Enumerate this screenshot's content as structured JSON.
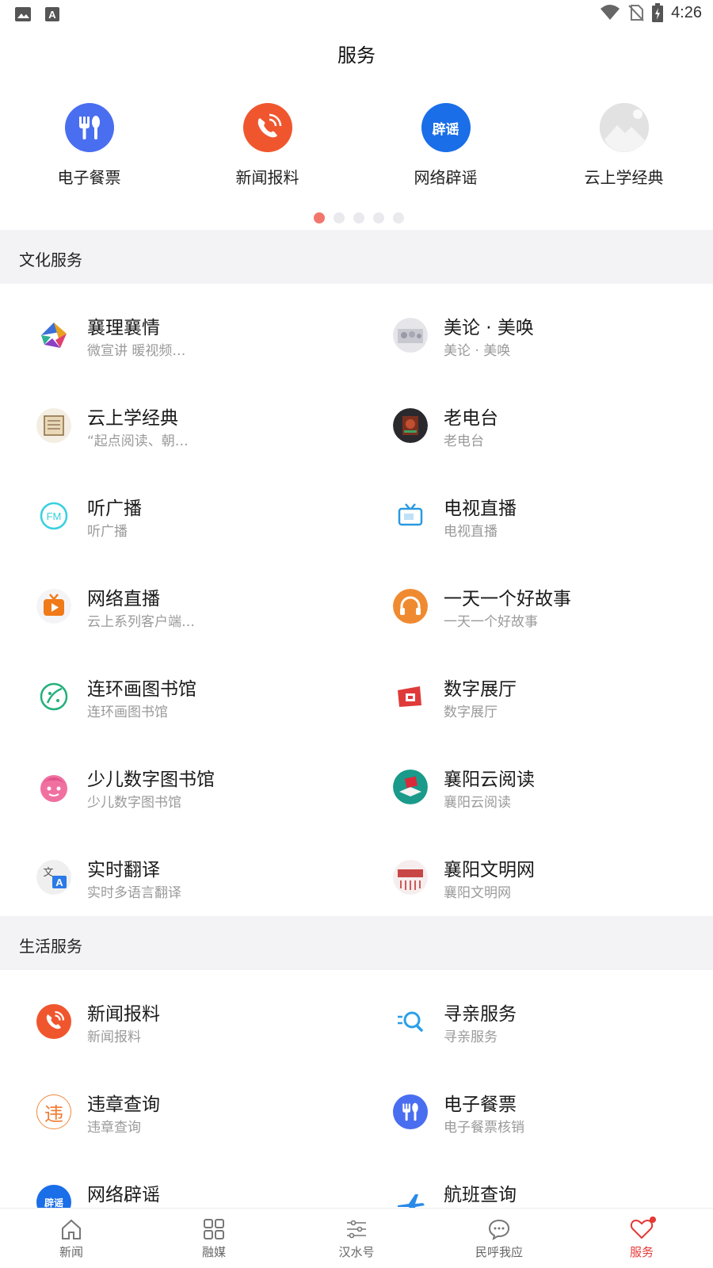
{
  "status_bar": {
    "time": "4:26"
  },
  "page_title": "服务",
  "banner": [
    {
      "label": "电子餐票",
      "icon": "fork-spoon-icon",
      "color": "#4a6ef0"
    },
    {
      "label": "新闻报料",
      "icon": "phone-icon",
      "color": "#f0562e"
    },
    {
      "label": "网络辟谣",
      "icon": "rumor-badge-icon",
      "badge": "辟谣",
      "color": "#1a6ee8"
    },
    {
      "label": "云上学经典",
      "icon": "image-placeholder-icon",
      "color": "#d8d8d8"
    }
  ],
  "pager": {
    "pages": 5,
    "active": 0
  },
  "sections": {
    "culture": {
      "title": "文化服务",
      "items": [
        {
          "name": "襄理襄情",
          "sub": "微宣讲  暖视频…",
          "icon": "colorful-logo-icon"
        },
        {
          "name": "美论  ·  美唤",
          "sub": "美论  ·  美唤",
          "icon": "photo-thumb-icon"
        },
        {
          "name": "云上学经典",
          "sub": "“起点阅读、朝…",
          "icon": "scroll-icon"
        },
        {
          "name": "老电台",
          "sub": "老电台",
          "icon": "radio-photo-icon"
        },
        {
          "name": "听广播",
          "sub": "听广播",
          "icon": "fm-icon"
        },
        {
          "name": "电视直播",
          "sub": "电视直播",
          "icon": "tv-icon"
        },
        {
          "name": "网络直播",
          "sub": "云上系列客户端…",
          "icon": "live-play-icon"
        },
        {
          "name": "一天一个好故事",
          "sub": "一天一个好故事",
          "icon": "headphones-icon"
        },
        {
          "name": "连环画图书馆",
          "sub": "连环画图书馆",
          "icon": "palette-icon"
        },
        {
          "name": "数字展厅",
          "sub": "数字展厅",
          "icon": "exhibition-icon"
        },
        {
          "name": "少儿数字图书馆",
          "sub": "少儿数字图书馆",
          "icon": "child-face-icon"
        },
        {
          "name": "襄阳云阅读",
          "sub": "襄阳云阅读",
          "icon": "cloud-reading-icon"
        },
        {
          "name": "实时翻译",
          "sub": "实时多语言翻译",
          "icon": "translate-icon"
        },
        {
          "name": "襄阳文明网",
          "sub": "襄阳文明网",
          "icon": "civilization-logo-icon"
        }
      ]
    },
    "life": {
      "title": "生活服务",
      "items": [
        {
          "name": "新闻报料",
          "sub": "新闻报料",
          "icon": "phone-icon"
        },
        {
          "name": "寻亲服务",
          "sub": "寻亲服务",
          "icon": "search-person-icon"
        },
        {
          "name": "违章查询",
          "sub": "违章查询",
          "icon": "violation-icon",
          "glyph": "违"
        },
        {
          "name": "电子餐票",
          "sub": "电子餐票核销",
          "icon": "fork-spoon-icon"
        },
        {
          "name": "网络辟谣",
          "sub": "",
          "icon": "rumor-badge-icon",
          "badge": "辟谣"
        },
        {
          "name": "航班查询",
          "sub": "",
          "icon": "airplane-icon"
        }
      ]
    }
  },
  "bottom_nav": [
    {
      "label": "新闻",
      "icon": "home-icon"
    },
    {
      "label": "融媒",
      "icon": "grid-icon"
    },
    {
      "label": "汉水号",
      "icon": "sliders-icon"
    },
    {
      "label": "民呼我应",
      "icon": "chat-icon"
    },
    {
      "label": "服务",
      "icon": "heart-icon",
      "active": true
    }
  ],
  "colors": {
    "accent": "#e53935",
    "pager_active": "#f2766b",
    "section_bg": "#f3f3f6"
  }
}
